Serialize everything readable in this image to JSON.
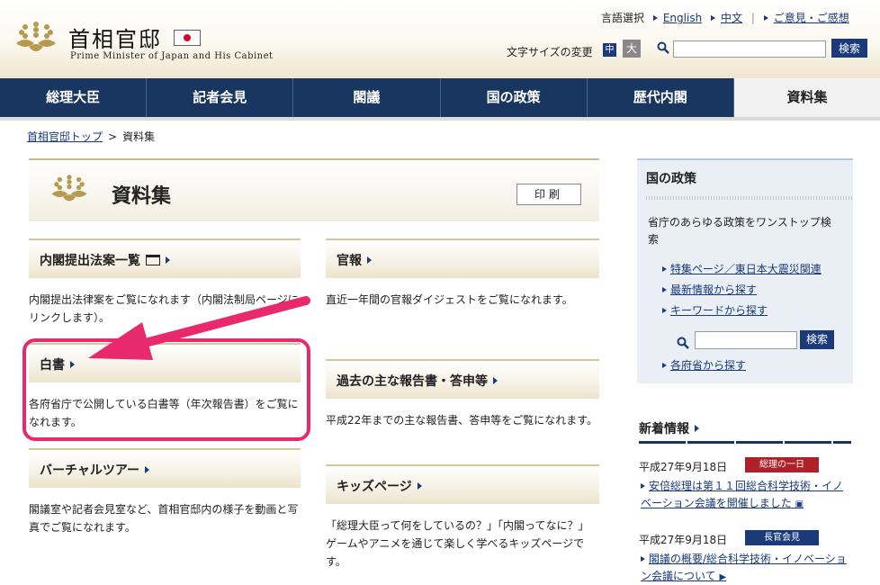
{
  "header": {
    "logo_title": "首相官邸",
    "logo_subtitle": "Prime Minister of Japan and His Cabinet",
    "lang_label": "言語選択",
    "lang_english": "English",
    "lang_chinese": "中文",
    "feedback": "ご意見・ご感想",
    "font_size_label": "文字サイズの変更",
    "font_mid": "中",
    "font_large": "大",
    "search_placeholder": "",
    "search_button": "検索"
  },
  "nav": {
    "items": [
      {
        "label": "総理大臣"
      },
      {
        "label": "記者会見"
      },
      {
        "label": "閣議"
      },
      {
        "label": "国の政策"
      },
      {
        "label": "歴代内閣"
      },
      {
        "label": "資料集"
      }
    ]
  },
  "breadcrumb": {
    "home": "首相官邸トップ",
    "separator": ">",
    "current": "資料集"
  },
  "page": {
    "title": "資料集",
    "print_button": "印刷"
  },
  "sections": {
    "bills": {
      "title": "内閣提出法案一覧",
      "desc": "内閣提出法律案をご覧になれます（内閣法制局ページにリンクします）。"
    },
    "gazette": {
      "title": "官報",
      "desc": "直近一年間の官報ダイジェストをご覧になれます。"
    },
    "whitepaper": {
      "title": "白書",
      "desc": "各府省庁で公開している白書等（年次報告書）をご覧になれます。"
    },
    "reports": {
      "title": "過去の主な報告書・答申等",
      "desc": "平成22年までの主な報告書、答申等をご覧になれます。"
    },
    "tour": {
      "title": "バーチャルツアー",
      "desc": "閣議室や記者会見室など、首相官邸内の様子を動画と写真でご覧になれます。"
    },
    "kids": {
      "title": "キッズページ",
      "desc": "「総理大臣って何をしているの？」「内閣ってなに？」ゲームやアニメを通じて楽しく学べるキッズページです。"
    }
  },
  "sidebar": {
    "title": "国の政策",
    "desc": "省庁のあらゆる政策をワンストップ検索",
    "links": [
      "特集ページ／東日本大震災関連",
      "最新情報から探す",
      "キーワードから探す"
    ],
    "search_button": "検索",
    "last_link": "各府省から探す"
  },
  "news": {
    "title": "新着情報",
    "items": [
      {
        "date": "平成27年9月18日",
        "badge": "総理の一日",
        "badge_color": "#b0202a",
        "text": "安倍総理は第１１回総合科学技術・イノベーション会議を開催しました"
      },
      {
        "date": "平成27年9月18日",
        "badge": "長官会見",
        "badge_color": "#1a3a7a",
        "text": "閣議の概要/総合科学技術・イノベーション会議について"
      }
    ]
  },
  "annotation": {
    "color": "#e82a6c"
  }
}
